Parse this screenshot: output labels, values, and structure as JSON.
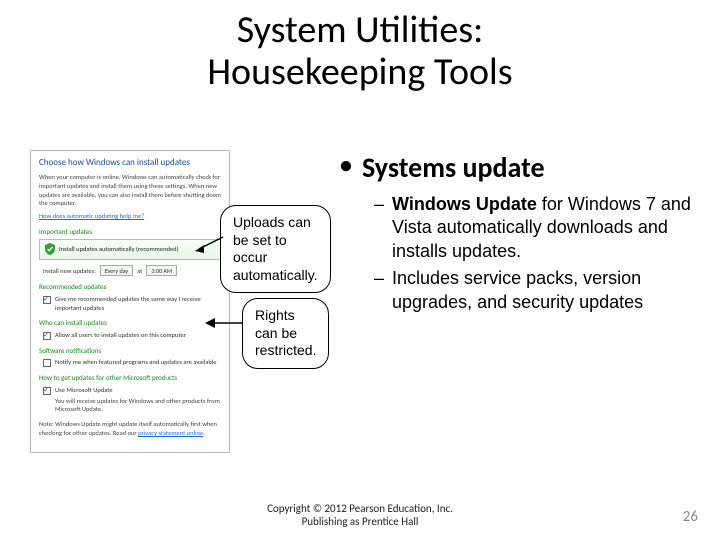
{
  "title_line1": "System Utilities:",
  "title_line2": "Housekeeping Tools",
  "panel": {
    "heading": "Choose how Windows can install updates",
    "intro": "When your computer is online, Windows can automatically check for important updates and install them using these settings. When new updates are available, you can also install them before shutting down the computer.",
    "help_link": "How does automatic updating help me?",
    "important_label": "Important updates",
    "recommended_option": "Install updates automatically (recommended)",
    "schedule_prefix": "Install new updates:",
    "schedule_day": "Every day",
    "schedule_at": "at",
    "schedule_time": "3:00 AM",
    "rec_label": "Recommended updates",
    "rec_cb": "Give me recommended updates the same way I receive important updates",
    "who_label": "Who can install updates",
    "who_cb": "Allow all users to install updates on this computer",
    "soft_label": "Software notifications",
    "soft_cb": "Notify me when featured programs and updates are available",
    "ms_label": "How to get updates for other Microsoft products",
    "ms_cb": "Use Microsoft Update",
    "ms_note": "You will receive updates for Windows and other products from Microsoft Update.",
    "note": "Note: Windows Update might update itself automatically first when checking for other updates. Read our",
    "note_link": "privacy statement online"
  },
  "callout1": "Uploads can be set to occur automatically.",
  "callout2": "Rights can be restricted.",
  "bullet_main": "Systems update",
  "sub1_bold": "Windows Update",
  "sub1_rest": " for Windows 7 and Vista automatically downloads and installs updates.",
  "sub2": "Includes service packs, version upgrades, and security updates",
  "copyright_l1": "Copyright © 2012 Pearson Education, Inc.",
  "copyright_l2": "Publishing as Prentice Hall",
  "page_number": "26"
}
